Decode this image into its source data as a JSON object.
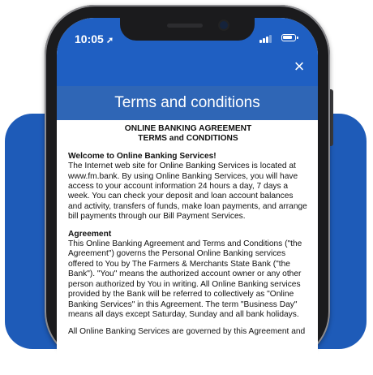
{
  "status_bar": {
    "time": "10:05",
    "location_icon": "location-arrow-icon",
    "signal_icon": "cellular-signal-icon",
    "battery_icon": "battery-icon"
  },
  "header": {
    "close_icon": "close-icon",
    "close_glyph": "×",
    "title": "Terms and conditions"
  },
  "document": {
    "heading_line1": "ONLINE BANKING AGREEMENT",
    "heading_line2": "TERMS and CONDITIONS",
    "sections": [
      {
        "title": "Welcome to Online Banking Services!",
        "body": "The Internet web site for Online Banking Services is located at www.fm.bank. By using Online Banking Services, you will have access to your account information 24 hours a day, 7 days a week. You can check your deposit and loan account balances and activity, transfers of funds, make loan payments, and arrange bill payments through our Bill Payment Services."
      },
      {
        "title": "Agreement",
        "body": "This Online Banking Agreement and Terms and Conditions (\"the Agreement\") governs the Personal Online Banking services offered to You by The Farmers & Merchants State Bank (\"the Bank\"). \"You\" means the authorized account owner or any other person authorized by You in writing. All Online Banking services provided by the Bank will be referred to collectively as \"Online Banking Services\" in this Agreement. The term \"Business Day\" means all days except Saturday, Sunday and all bank holidays."
      }
    ],
    "trailing_paragraph": "All Online Banking Services are governed by this Agreement and"
  },
  "colors": {
    "brand_blue": "#1f5fc2",
    "title_bar_blue": "#2f66b6",
    "background_shape_blue": "#1e5bb8",
    "device_frame": "#1b1b1d"
  }
}
